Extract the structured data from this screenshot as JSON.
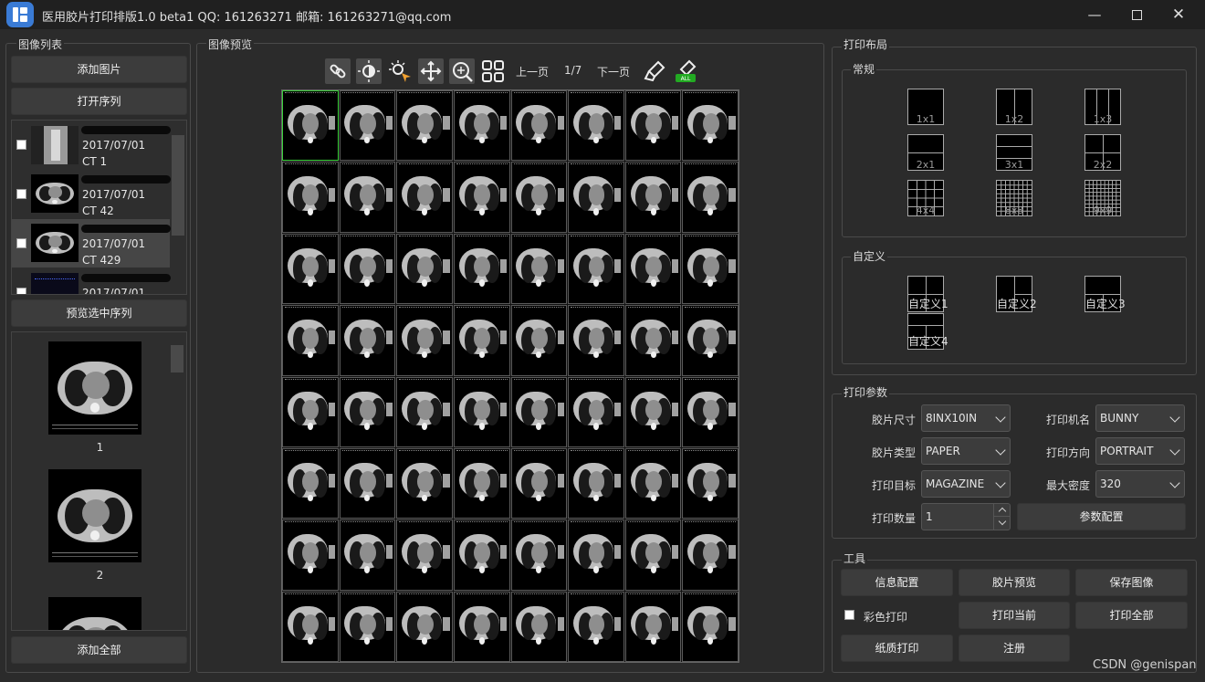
{
  "window": {
    "title": "医用胶片打印排版1.0 beta1 QQ: 161263271 邮箱: 161263271@qq.com",
    "minimize_icon": "minimize-icon",
    "maximize_icon": "maximize-icon",
    "close_icon": "close-icon",
    "minimize_glyph": "—",
    "close_glyph": "✕"
  },
  "left_panel": {
    "group_title": "图像列表",
    "add_image_label": "添加图片",
    "open_series_label": "打开序列",
    "series": [
      {
        "date": "2017/07/01",
        "modality": "CT 1",
        "checked": false,
        "selected": false
      },
      {
        "date": "2017/07/01",
        "modality": "CT 42",
        "checked": false,
        "selected": false
      },
      {
        "date": "2017/07/01",
        "modality": "CT 429",
        "checked": false,
        "selected": true
      },
      {
        "date": "2017/07/01",
        "modality": "",
        "checked": false,
        "selected": false
      }
    ],
    "preview_selected_label": "预览选中序列",
    "preview_items": [
      {
        "number": "1"
      },
      {
        "number": "2"
      }
    ],
    "add_all_label": "添加全部"
  },
  "center_panel": {
    "group_title": "图像预览",
    "toolbar": {
      "tools": [
        "link-icon",
        "brightness-icon",
        "window-level-icon",
        "move-icon",
        "zoom-icon",
        "layout-grid-icon"
      ],
      "prev_page_label": "上一页",
      "page_indicator": "1/7",
      "next_page_label": "下一页",
      "clear_tools": [
        "eraser-icon",
        "clear-all-icon"
      ]
    },
    "grid": {
      "rows": 8,
      "cols": 8,
      "active_cell": 0
    }
  },
  "right_panel": {
    "layout_group_title": "打印布局",
    "common_title": "常规",
    "common_layouts": [
      "1x1",
      "1x2",
      "1x3",
      "2x1",
      "3x1",
      "2x2",
      "4x4",
      "8x8",
      "9x9"
    ],
    "custom_title": "自定义",
    "custom_layouts": [
      "自定义1",
      "自定义2",
      "自定义3",
      "自定义4"
    ],
    "params_title": "打印参数",
    "params": {
      "film_size_label": "胶片尺寸",
      "film_size_value": "8INX10IN",
      "printer_name_label": "打印机名",
      "printer_name_value": "BUNNY",
      "film_type_label": "胶片类型",
      "film_type_value": "PAPER",
      "print_direction_label": "打印方向",
      "print_direction_value": "PORTRAIT",
      "print_target_label": "打印目标",
      "print_target_value": "MAGAZINE",
      "max_density_label": "最大密度",
      "max_density_value": "320",
      "print_count_label": "打印数量",
      "print_count_value": "1",
      "param_config_label": "参数配置"
    },
    "tools_title": "工具",
    "tools": {
      "info_config_label": "信息配置",
      "film_preview_label": "胶片预览",
      "save_image_label": "保存图像",
      "color_print_label": "彩色打印",
      "print_current_label": "打印当前",
      "print_all_label": "打印全部",
      "paper_print_label": "纸质打印",
      "register_label": "注册"
    }
  },
  "watermark": "CSDN @genispan"
}
